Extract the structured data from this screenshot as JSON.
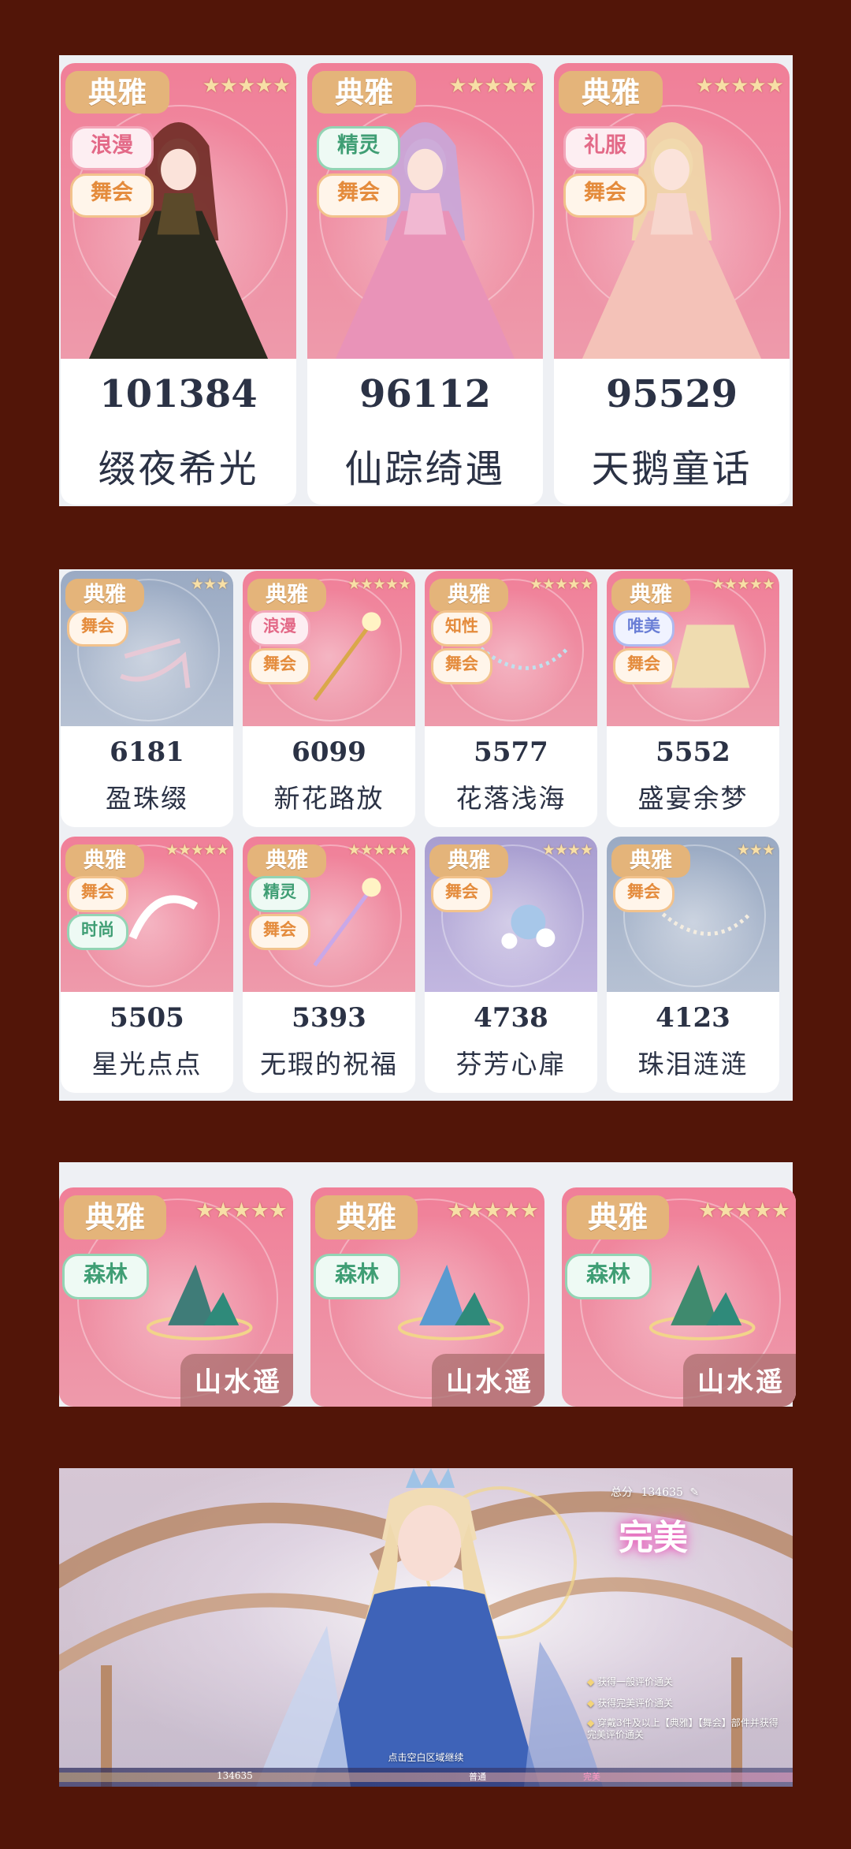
{
  "section1": {
    "cards": [
      {
        "main_tag": "典雅",
        "stars": "★★★★★",
        "tags": [
          {
            "text": "浪漫",
            "color": "pink"
          },
          {
            "text": "舞会",
            "color": "orange"
          }
        ],
        "score": "101384",
        "name": "缀夜希光"
      },
      {
        "main_tag": "典雅",
        "stars": "★★★★★",
        "tags": [
          {
            "text": "精灵",
            "color": "green"
          },
          {
            "text": "舞会",
            "color": "orange"
          }
        ],
        "score": "96112",
        "name": "仙踪绮遇"
      },
      {
        "main_tag": "典雅",
        "stars": "★★★★★",
        "tags": [
          {
            "text": "礼服",
            "color": "pink"
          },
          {
            "text": "舞会",
            "color": "orange"
          }
        ],
        "score": "95529",
        "name": "天鹅童话"
      }
    ]
  },
  "section2": {
    "cards": [
      {
        "main_tag": "典雅",
        "stars": "★★★",
        "tags": [
          {
            "text": "舞会",
            "color": "orange"
          }
        ],
        "score": "6181",
        "name": "盈珠缀",
        "theme": "blue"
      },
      {
        "main_tag": "典雅",
        "stars": "★★★★★",
        "tags": [
          {
            "text": "浪漫",
            "color": "pink"
          },
          {
            "text": "舞会",
            "color": "orange"
          }
        ],
        "score": "6099",
        "name": "新花路放",
        "theme": "pink"
      },
      {
        "main_tag": "典雅",
        "stars": "★★★★★",
        "tags": [
          {
            "text": "知性",
            "color": "orange"
          },
          {
            "text": "舞会",
            "color": "orange"
          }
        ],
        "score": "5577",
        "name": "花落浅海",
        "theme": "pink"
      },
      {
        "main_tag": "典雅",
        "stars": "★★★★★",
        "tags": [
          {
            "text": "唯美",
            "color": "blue"
          },
          {
            "text": "舞会",
            "color": "orange"
          }
        ],
        "score": "5552",
        "name": "盛宴余梦",
        "theme": "pink"
      },
      {
        "main_tag": "典雅",
        "stars": "★★★★★",
        "tags": [
          {
            "text": "舞会",
            "color": "orange"
          },
          {
            "text": "时尚",
            "color": "green"
          }
        ],
        "score": "5505",
        "name": "星光点点",
        "theme": "pink"
      },
      {
        "main_tag": "典雅",
        "stars": "★★★★★",
        "tags": [
          {
            "text": "精灵",
            "color": "green"
          },
          {
            "text": "舞会",
            "color": "orange"
          }
        ],
        "score": "5393",
        "name": "无瑕的祝福",
        "theme": "pink"
      },
      {
        "main_tag": "典雅",
        "stars": "★★★★",
        "tags": [
          {
            "text": "舞会",
            "color": "orange"
          }
        ],
        "score": "4738",
        "name": "芬芳心扉",
        "theme": "purple"
      },
      {
        "main_tag": "典雅",
        "stars": "★★★",
        "tags": [
          {
            "text": "舞会",
            "color": "orange"
          }
        ],
        "score": "4123",
        "name": "珠泪涟涟",
        "theme": "blue"
      }
    ]
  },
  "section3": {
    "cards": [
      {
        "main_tag": "典雅",
        "stars": "★★★★★",
        "tags": [
          {
            "text": "森林",
            "color": "green"
          }
        ],
        "set_name": "山水遥"
      },
      {
        "main_tag": "典雅",
        "stars": "★★★★★",
        "tags": [
          {
            "text": "森林",
            "color": "green"
          }
        ],
        "set_name": "山水遥"
      },
      {
        "main_tag": "典雅",
        "stars": "★★★★★",
        "tags": [
          {
            "text": "森林",
            "color": "green"
          }
        ],
        "set_name": "山水遥"
      }
    ]
  },
  "result": {
    "total_label": "总分",
    "total_score": "134635",
    "grade": "完美",
    "conditions": [
      "获得一般评价通关",
      "获得完美评价通关",
      "穿戴3件及以上【典雅】【舞会】部件并获得完美评价通关"
    ],
    "hint": "点击空白区域继续",
    "bar_score": "134635",
    "bar_labels": [
      "普通",
      "完美"
    ]
  }
}
